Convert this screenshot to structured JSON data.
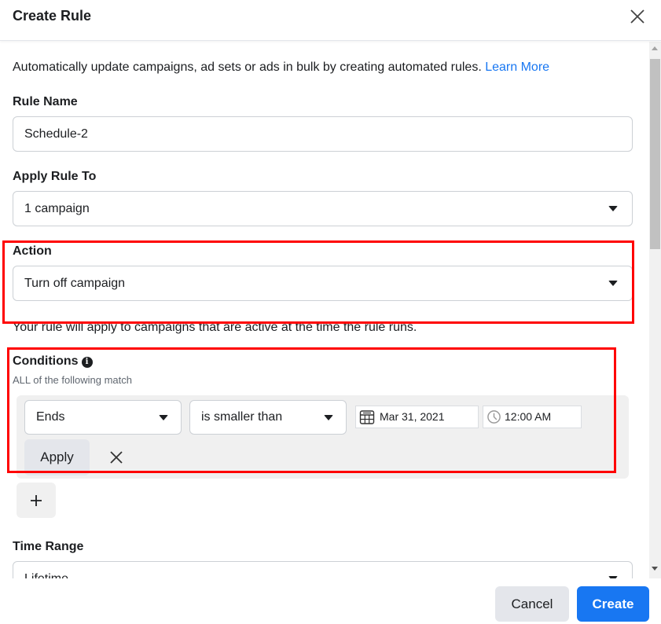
{
  "header": {
    "title": "Create Rule",
    "close_icon": "close-icon"
  },
  "intro": {
    "text": "Automatically update campaigns, ad sets or ads in bulk by creating automated rules. ",
    "link": "Learn More"
  },
  "rule_name": {
    "label": "Rule Name",
    "value": "Schedule-2"
  },
  "apply_rule_to": {
    "label": "Apply Rule To",
    "value": "1 campaign"
  },
  "action": {
    "label": "Action",
    "value": "Turn off campaign",
    "note": "Your rule will apply to campaigns that are active at the time the rule runs."
  },
  "conditions": {
    "label": "Conditions",
    "info_icon": "info-icon",
    "subtitle": "ALL of the following match",
    "rows": [
      {
        "field": "Ends",
        "operator": "is smaller than",
        "date": "Mar 31, 2021",
        "time": "12:00 AM"
      }
    ],
    "apply_label": "Apply",
    "add_label": "+"
  },
  "time_range": {
    "label": "Time Range",
    "value": "Lifetime"
  },
  "footer": {
    "cancel_label": "Cancel",
    "create_label": "Create"
  },
  "colors": {
    "primary": "#1877f2",
    "highlight": "#ff0000"
  }
}
